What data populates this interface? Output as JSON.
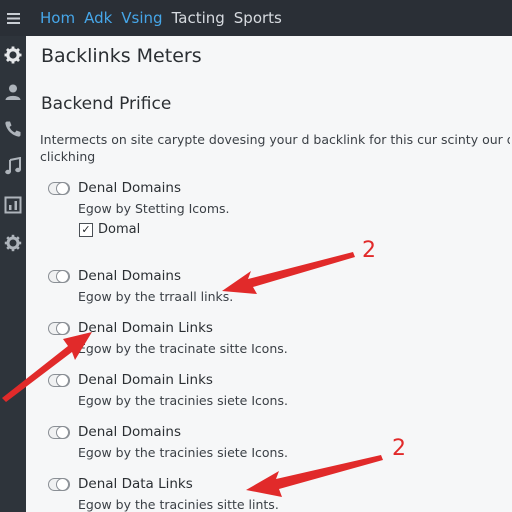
{
  "nav": {
    "menu_icon": "hamburger-icon",
    "tabs": [
      {
        "label": "Hom",
        "active": true
      },
      {
        "label": "Adk",
        "active": true
      },
      {
        "label": "Vsing",
        "active": true
      },
      {
        "label": "Tacting",
        "active": false
      },
      {
        "label": "Sports",
        "active": false
      }
    ]
  },
  "sidebar": {
    "icons": [
      "gear-icon",
      "user-icon",
      "phone-icon",
      "music-icon",
      "chart-icon",
      "settings-icon"
    ]
  },
  "main": {
    "page_title": "Backlinks Meters",
    "section_title": "Backend Prifice",
    "intro_lines": [
      "Intermects on site carypte dovesing your d backlink for this cur scinty our dom",
      "clickhing"
    ],
    "settings": [
      {
        "label": "Denal Domains",
        "desc": "Egow by Stetting Icoms."
      },
      {
        "label": "Denal Domains",
        "desc": "Egow by the trraall links."
      },
      {
        "label": "Denal Domain Links",
        "desc": "Egow by the tracinate sitte Icons."
      },
      {
        "label": "Denal Domain Links",
        "desc": "Egow by the tracinies siete Icons."
      },
      {
        "label": "Denal Domains",
        "desc": "Egow by the tracinies siete Icons."
      },
      {
        "label": "Denal Data Links",
        "desc": "Egow by the tracinies sitte lints."
      }
    ],
    "checkbox": {
      "label": "Domal",
      "checked": true,
      "mark": "✓"
    }
  },
  "annotations": {
    "color": "#e12a2a",
    "numbers": [
      "2",
      "2"
    ]
  },
  "colors": {
    "topbar": "#2a2f36",
    "sidebar": "#2e343b",
    "accent": "#46a6e8"
  }
}
